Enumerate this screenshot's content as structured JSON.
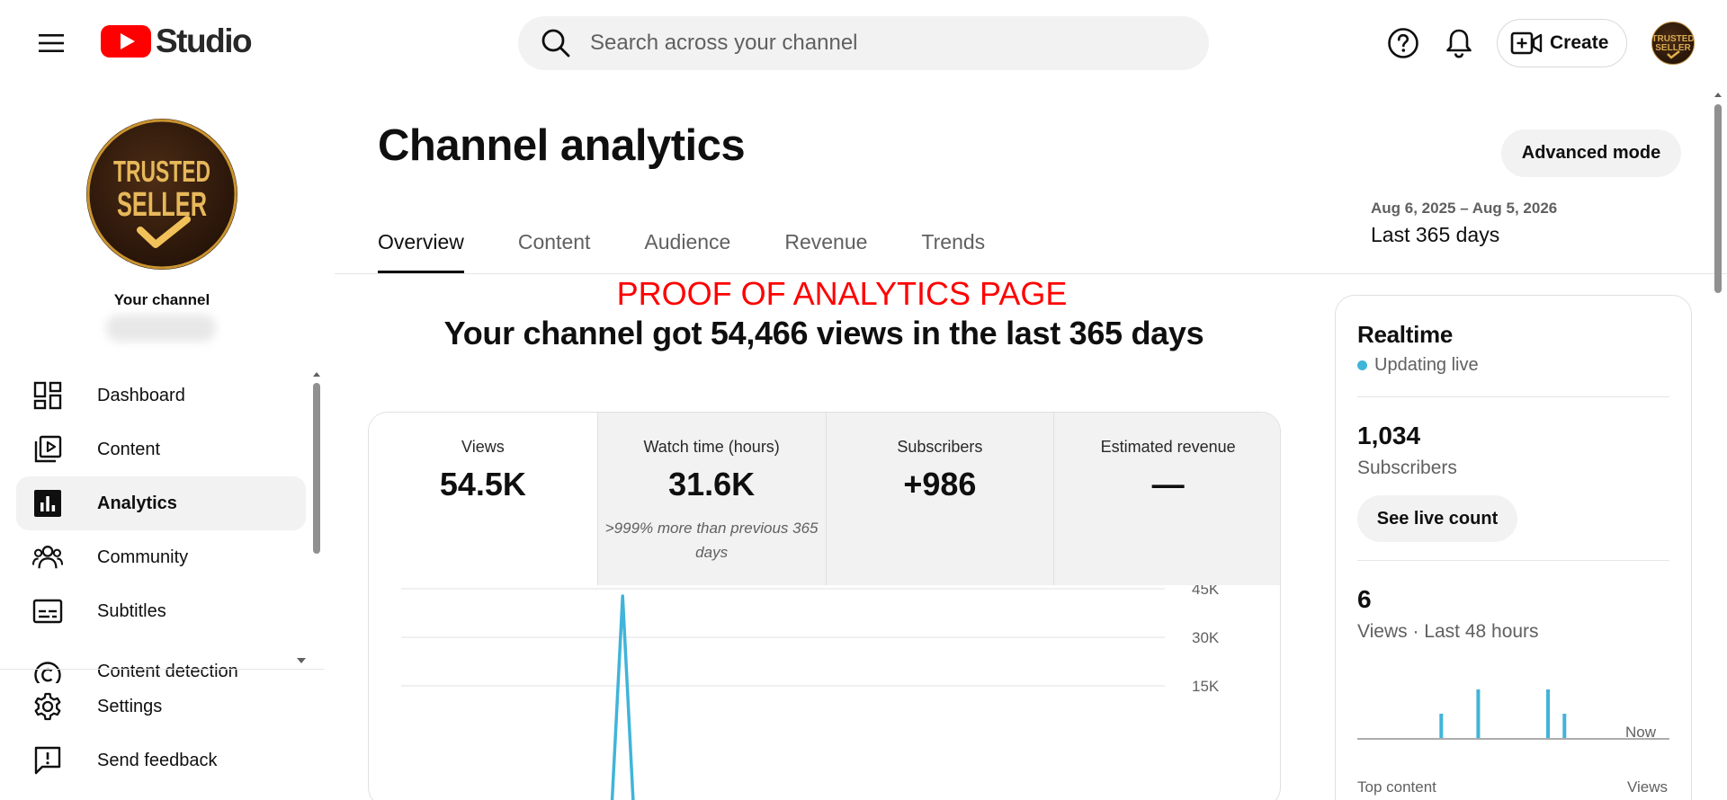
{
  "app": {
    "logo_text": "Studio"
  },
  "search": {
    "placeholder": "Search across your channel"
  },
  "header": {
    "create_label": "Create"
  },
  "sidebar": {
    "channel_label": "Your channel",
    "items": [
      {
        "label": "Dashboard",
        "icon": "dashboard-icon"
      },
      {
        "label": "Content",
        "icon": "content-icon"
      },
      {
        "label": "Analytics",
        "icon": "analytics-icon",
        "active": true
      },
      {
        "label": "Community",
        "icon": "community-icon"
      },
      {
        "label": "Subtitles",
        "icon": "subtitles-icon"
      },
      {
        "label": "Content detection",
        "icon": "copyright-icon"
      }
    ],
    "bottom_items": [
      {
        "label": "Settings",
        "icon": "gear-icon"
      },
      {
        "label": "Send feedback",
        "icon": "feedback-icon"
      }
    ]
  },
  "page": {
    "title": "Channel analytics",
    "advanced_mode_label": "Advanced mode",
    "date_range": "Aug 6, 2025 – Aug 5, 2026",
    "date_label": "Last 365 days",
    "tabs": [
      {
        "label": "Overview",
        "active": true
      },
      {
        "label": "Content"
      },
      {
        "label": "Audience"
      },
      {
        "label": "Revenue"
      },
      {
        "label": "Trends"
      }
    ],
    "proof_text": "PROOF OF ANALYTICS PAGE",
    "headline": "Your channel got 54,466 views in the last 365 days"
  },
  "metrics": [
    {
      "label": "Views",
      "value": "54.5K",
      "note": ""
    },
    {
      "label": "Watch time (hours)",
      "value": "31.6K",
      "note": ">999% more than previous 365 days"
    },
    {
      "label": "Subscribers",
      "value": "+986",
      "note": ""
    },
    {
      "label": "Estimated revenue",
      "value": "—",
      "note": ""
    }
  ],
  "chart_data": {
    "type": "line",
    "y_ticks": [
      "45K",
      "30K",
      "15K"
    ],
    "ylim": [
      0,
      45000
    ],
    "x_visible_range": [
      0,
      100
    ],
    "series": [
      {
        "x": [
          0,
          27.5,
          29,
          30.5
        ],
        "y": [
          0,
          0,
          45000,
          0
        ]
      }
    ],
    "color": "#41b4d9"
  },
  "realtime": {
    "title": "Realtime",
    "status": "Updating live",
    "subscribers_value": "1,034",
    "subscribers_label": "Subscribers",
    "live_count_label": "See live count",
    "views_value": "6",
    "views_label": "Views · Last 48 hours",
    "now_label": "Now",
    "top_content_label": "Top content",
    "top_views_label": "Views",
    "bars": [
      0,
      0,
      0,
      0,
      0,
      0,
      0,
      0,
      0,
      0,
      0,
      0,
      0,
      0,
      0,
      0,
      0,
      0,
      0,
      0,
      1,
      0,
      0,
      0,
      0,
      0,
      0,
      0,
      0,
      2,
      0,
      0,
      0,
      0,
      0,
      0,
      0,
      0,
      0,
      0,
      0,
      0,
      0,
      0,
      0,
      0,
      2,
      0,
      0,
      0,
      1,
      0,
      0,
      0,
      0,
      0,
      0,
      0,
      0,
      0,
      0,
      0,
      0,
      0,
      0,
      0,
      0,
      0,
      0,
      0,
      0,
      0,
      0,
      0,
      0,
      0
    ],
    "bar_color": "#41b4d9"
  }
}
